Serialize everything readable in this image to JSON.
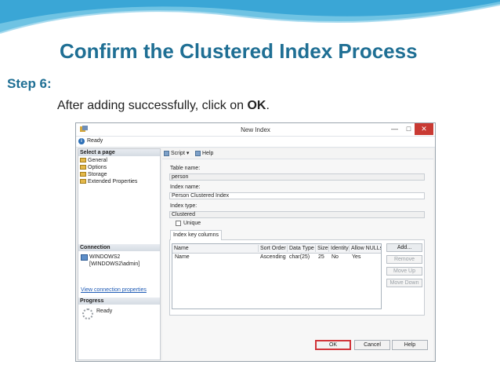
{
  "slide": {
    "title": "Confirm the Clustered Index Process",
    "step": "Step 6:",
    "instruction_prefix": "After adding successfully, click on ",
    "instruction_bold": "OK",
    "instruction_suffix": "."
  },
  "dialog": {
    "title": "New Index",
    "window_buttons": {
      "minimize": "—",
      "maximize": "□",
      "close": "✕"
    },
    "status": "Ready",
    "select_page_header": "Select a page",
    "pages": [
      "General",
      "Options",
      "Storage",
      "Extended Properties"
    ],
    "connection_header": "Connection",
    "connection_server": "WINDOWS2",
    "connection_user": "[WINDOWS2\\admin]",
    "view_connection_properties": "View connection properties",
    "progress_header": "Progress",
    "progress_status": "Ready",
    "toolbar": {
      "script": "Script",
      "script_arrow": "▾",
      "help": "Help"
    },
    "table_name_label": "Table name:",
    "table_name_value": "person",
    "index_name_label": "Index name:",
    "index_name_value": "Person Clustered Index",
    "index_type_label": "Index type:",
    "index_type_value": "Clustered",
    "unique_label": "Unique",
    "tab_label": "Index key columns",
    "grid_headers": [
      "Name",
      "Sort Order",
      "Data Type",
      "Size",
      "Identity",
      "Allow NULLs"
    ],
    "grid_rows": [
      [
        "Name",
        "Ascending",
        "char(25)",
        "25",
        "No",
        "Yes"
      ]
    ],
    "side_buttons": {
      "add": "Add...",
      "remove": "Remove",
      "move_up": "Move Up",
      "move_down": "Move Down"
    },
    "buttons": {
      "ok": "OK",
      "cancel": "Cancel",
      "help": "Help"
    }
  }
}
